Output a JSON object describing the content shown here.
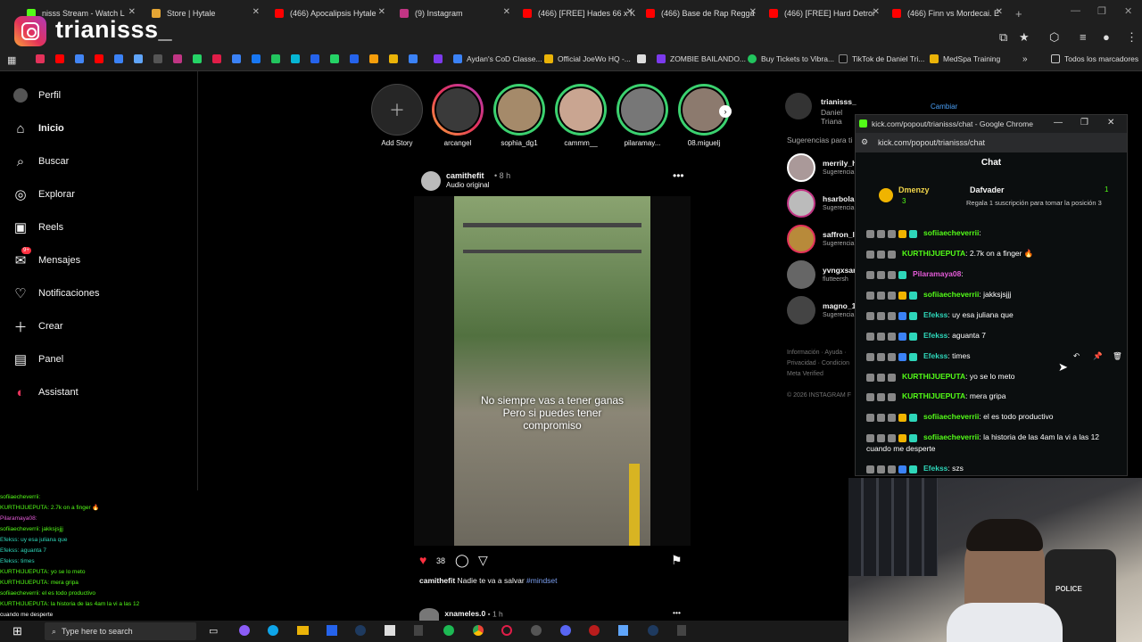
{
  "browser": {
    "tabs": [
      {
        "label": "nisss Stream - Watch L",
        "color": "#53fc18"
      },
      {
        "label": "Store | Hytale",
        "color": "#e4a534"
      },
      {
        "label": "(466) Apocalipsis Hytale",
        "color": "#ff0000"
      },
      {
        "label": "(9) Instagram",
        "color": "#c13584"
      },
      {
        "label": "(466) [FREE] Hades 66 x K",
        "color": "#ff0000"
      },
      {
        "label": "(466) Base de Rap Regga",
        "color": "#ff0000"
      },
      {
        "label": "(466) [FREE] Hard Detroi",
        "color": "#ff0000"
      },
      {
        "label": "(466) Finn vs Mordecai. E",
        "color": "#ff0000"
      }
    ],
    "new_tab": "+",
    "bookmarks": [
      "Aydan's CoD Classe...",
      "Official JoeWo HQ -...",
      "ZOMBIE BAILANDO...",
      "Buy Tickets to Vibra...",
      "TikTok de Daniel Tri...",
      "MedSpa Training",
      "Todos los marcadores"
    ]
  },
  "stream": {
    "channel_name": "trianisss_"
  },
  "instagram": {
    "nav": [
      "Perfil",
      "Inicio",
      "Buscar",
      "Explorar",
      "Reels",
      "Mensajes",
      "Notificaciones",
      "Crear",
      "Panel",
      "Assistant"
    ],
    "messages_badge": "9+",
    "stories": [
      "Add Story",
      "arcangel",
      "sophia_dg1",
      "cammm__",
      "pilaramay...",
      "08.miguelj"
    ],
    "post": {
      "user": "camithefit",
      "time": "8 h",
      "audio": "Audio original",
      "overlay_lines": [
        "No siempre vas a tener ganas",
        "Pero si puedes tener",
        "compromiso"
      ],
      "likes": "38",
      "caption_user": "camithefit",
      "caption_text": "Nadie te va a salvar",
      "hashtag": "#mindset"
    },
    "next_post": {
      "user": "xnameles.0",
      "time": "1 h"
    },
    "account": {
      "username": "trianisss_",
      "name": "Daniel Triana",
      "switch": "Cambiar"
    },
    "suggestions_title": "Sugerencias para ti",
    "suggestions": [
      {
        "user": "merrily_h",
        "sub": "Sugerencia"
      },
      {
        "user": "hsarbola",
        "sub": "Sugerencia"
      },
      {
        "user": "saffron_l",
        "sub": "Sugerencia"
      },
      {
        "user": "yvngxsar",
        "sub": "flutteersh"
      },
      {
        "user": "magno_1",
        "sub": "Sugerencia"
      }
    ],
    "footer": [
      "Información · Ayuda ·",
      "Privacidad · Condicion",
      "Meta Verified",
      "© 2026 INSTAGRAM F"
    ]
  },
  "kick_popout": {
    "window_title": "kick.com/popout/trianisss/chat - Google Chrome",
    "url": "kick.com/popout/trianisss/chat",
    "header": "Chat",
    "pinned": {
      "user1": "Dmenzy",
      "user1_count": "3",
      "user2": "Dafvader",
      "count": "1",
      "text": "Regala 1 suscripción para tomar la posición 3"
    },
    "messages": [
      {
        "user": "sofiiaecheverrii",
        "text": ":",
        "color": "green"
      },
      {
        "user": "KURTHIJUEPUTA",
        "text": ": 2.7k on a finger 🔥",
        "color": "green"
      },
      {
        "user": "Pilaramaya08",
        "text": ":",
        "color": "pink"
      },
      {
        "user": "sofiiaecheverrii",
        "text": ": jakksjsjjj",
        "color": "green"
      },
      {
        "user": "Efekss",
        "text": ": uy esa juliana que",
        "color": "cyan"
      },
      {
        "user": "Efekss",
        "text": ": aguanta 7",
        "color": "cyan"
      },
      {
        "user": "Efekss",
        "text": ": times",
        "color": "cyan"
      },
      {
        "user": "KURTHIJUEPUTA",
        "text": ": yo se lo meto",
        "color": "green"
      },
      {
        "user": "KURTHIJUEPUTA",
        "text": ": mera gripa",
        "color": "green"
      },
      {
        "user": "sofiiaecheverrii",
        "text": ": el es todo productivo",
        "color": "green"
      },
      {
        "user": "sofiiaecheverrii",
        "text": ": la historia de las 4am la vi a las 12 cuando me desperte",
        "color": "green"
      },
      {
        "user": "Efekss",
        "text": ": szs",
        "color": "cyan"
      }
    ]
  },
  "overlay_chat": [
    "sofiiaecheverrii:",
    "KURTHIJUEPUTA: 2.7k on a finger 🔥",
    "Pilaramaya08:",
    "sofiiaecheverrii: jakksjsjjj",
    "Efekss: uy esa juliana que",
    "Efekss: aguanta 7",
    "Efekss: times",
    "KURTHIJUEPUTA: yo se lo meto",
    "KURTHIJUEPUTA: mera gripa",
    "sofiiaecheverrii: el es todo productivo",
    "KURTHIJUEPUTA: la historia de las 4am la vi a las 12",
    "cuando me desperte"
  ],
  "taskbar": {
    "search_placeholder": "Type here to search"
  }
}
